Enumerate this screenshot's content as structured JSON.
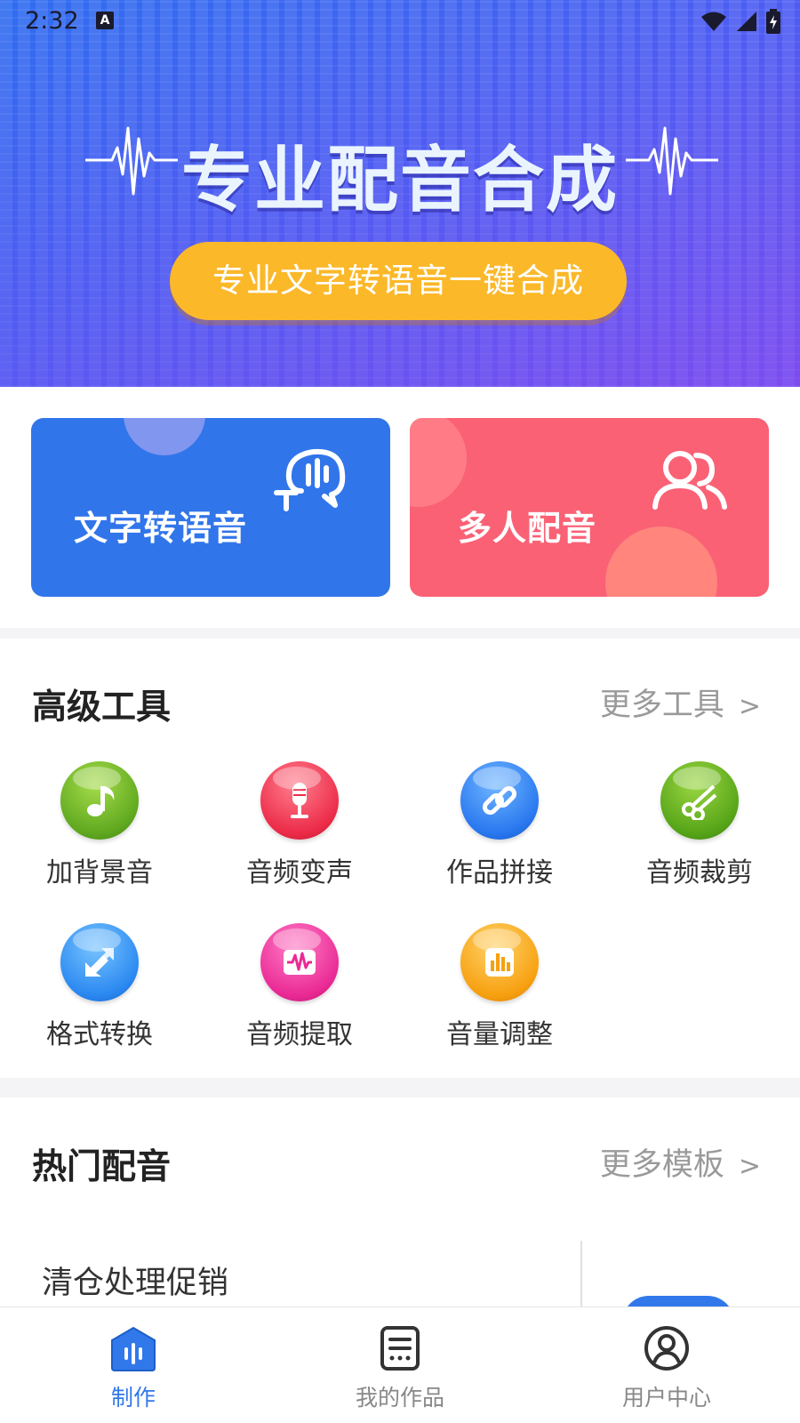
{
  "status_bar": {
    "time": "2:32",
    "notification_icon": "a-icon"
  },
  "banner": {
    "title": "专业配音合成",
    "button_label": "专业文字转语音一键合成"
  },
  "feature_cards": [
    {
      "label": "文字转语音",
      "icon": "speech-bubble-icon",
      "color": "#3175ea"
    },
    {
      "label": "多人配音",
      "icon": "people-icon",
      "color": "#fa6175"
    }
  ],
  "tools_section": {
    "title": "高级工具",
    "more_label": "更多工具",
    "more_chevron": ">",
    "tools": [
      {
        "label": "加背景音",
        "icon": "music-note-icon",
        "color": "#6ab62a"
      },
      {
        "label": "音频变声",
        "icon": "microphone-icon",
        "color": "#f0334f"
      },
      {
        "label": "作品拼接",
        "icon": "link-icon",
        "color": "#2b7ff0"
      },
      {
        "label": "音频裁剪",
        "icon": "scissors-icon",
        "color": "#5fae1e"
      },
      {
        "label": "格式转换",
        "icon": "convert-icon",
        "color": "#2a8cf2"
      },
      {
        "label": "音频提取",
        "icon": "waveform-icon",
        "color": "#ee2d98"
      },
      {
        "label": "音量调整",
        "icon": "volume-bars-icon",
        "color": "#f8a012"
      }
    ]
  },
  "hot_section": {
    "title": "热门配音",
    "more_label": "更多模板",
    "more_chevron": ">",
    "items": [
      {
        "title": "清仓处理促销"
      }
    ]
  },
  "bottom_nav": [
    {
      "label": "制作",
      "icon": "make-icon",
      "active": true
    },
    {
      "label": "我的作品",
      "icon": "document-icon",
      "active": false
    },
    {
      "label": "用户中心",
      "icon": "user-icon",
      "active": false
    }
  ],
  "colors": {
    "primary": "#3178ea",
    "accent_yellow": "#fbb829",
    "accent_red": "#fa6175"
  }
}
